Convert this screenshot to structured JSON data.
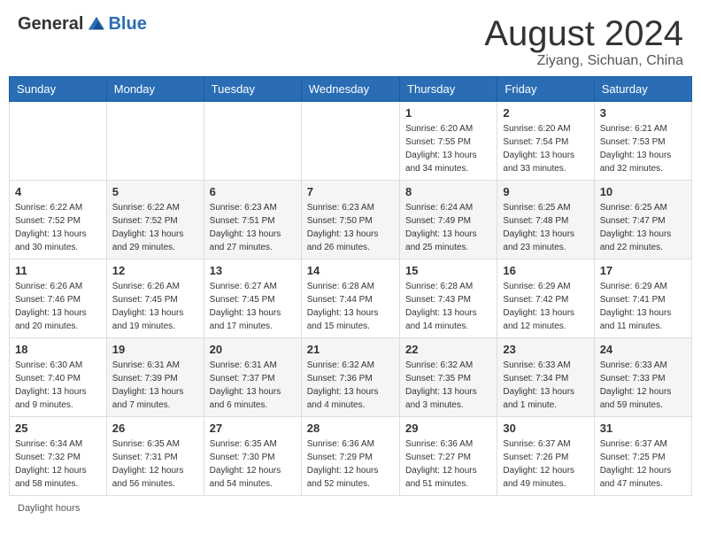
{
  "header": {
    "logo_general": "General",
    "logo_blue": "Blue",
    "month_year": "August 2024",
    "location": "Ziyang, Sichuan, China"
  },
  "days_of_week": [
    "Sunday",
    "Monday",
    "Tuesday",
    "Wednesday",
    "Thursday",
    "Friday",
    "Saturday"
  ],
  "weeks": [
    [
      {
        "day": "",
        "info": ""
      },
      {
        "day": "",
        "info": ""
      },
      {
        "day": "",
        "info": ""
      },
      {
        "day": "",
        "info": ""
      },
      {
        "day": "1",
        "info": "Sunrise: 6:20 AM\nSunset: 7:55 PM\nDaylight: 13 hours\nand 34 minutes."
      },
      {
        "day": "2",
        "info": "Sunrise: 6:20 AM\nSunset: 7:54 PM\nDaylight: 13 hours\nand 33 minutes."
      },
      {
        "day": "3",
        "info": "Sunrise: 6:21 AM\nSunset: 7:53 PM\nDaylight: 13 hours\nand 32 minutes."
      }
    ],
    [
      {
        "day": "4",
        "info": "Sunrise: 6:22 AM\nSunset: 7:52 PM\nDaylight: 13 hours\nand 30 minutes."
      },
      {
        "day": "5",
        "info": "Sunrise: 6:22 AM\nSunset: 7:52 PM\nDaylight: 13 hours\nand 29 minutes."
      },
      {
        "day": "6",
        "info": "Sunrise: 6:23 AM\nSunset: 7:51 PM\nDaylight: 13 hours\nand 27 minutes."
      },
      {
        "day": "7",
        "info": "Sunrise: 6:23 AM\nSunset: 7:50 PM\nDaylight: 13 hours\nand 26 minutes."
      },
      {
        "day": "8",
        "info": "Sunrise: 6:24 AM\nSunset: 7:49 PM\nDaylight: 13 hours\nand 25 minutes."
      },
      {
        "day": "9",
        "info": "Sunrise: 6:25 AM\nSunset: 7:48 PM\nDaylight: 13 hours\nand 23 minutes."
      },
      {
        "day": "10",
        "info": "Sunrise: 6:25 AM\nSunset: 7:47 PM\nDaylight: 13 hours\nand 22 minutes."
      }
    ],
    [
      {
        "day": "11",
        "info": "Sunrise: 6:26 AM\nSunset: 7:46 PM\nDaylight: 13 hours\nand 20 minutes."
      },
      {
        "day": "12",
        "info": "Sunrise: 6:26 AM\nSunset: 7:45 PM\nDaylight: 13 hours\nand 19 minutes."
      },
      {
        "day": "13",
        "info": "Sunrise: 6:27 AM\nSunset: 7:45 PM\nDaylight: 13 hours\nand 17 minutes."
      },
      {
        "day": "14",
        "info": "Sunrise: 6:28 AM\nSunset: 7:44 PM\nDaylight: 13 hours\nand 15 minutes."
      },
      {
        "day": "15",
        "info": "Sunrise: 6:28 AM\nSunset: 7:43 PM\nDaylight: 13 hours\nand 14 minutes."
      },
      {
        "day": "16",
        "info": "Sunrise: 6:29 AM\nSunset: 7:42 PM\nDaylight: 13 hours\nand 12 minutes."
      },
      {
        "day": "17",
        "info": "Sunrise: 6:29 AM\nSunset: 7:41 PM\nDaylight: 13 hours\nand 11 minutes."
      }
    ],
    [
      {
        "day": "18",
        "info": "Sunrise: 6:30 AM\nSunset: 7:40 PM\nDaylight: 13 hours\nand 9 minutes."
      },
      {
        "day": "19",
        "info": "Sunrise: 6:31 AM\nSunset: 7:39 PM\nDaylight: 13 hours\nand 7 minutes."
      },
      {
        "day": "20",
        "info": "Sunrise: 6:31 AM\nSunset: 7:37 PM\nDaylight: 13 hours\nand 6 minutes."
      },
      {
        "day": "21",
        "info": "Sunrise: 6:32 AM\nSunset: 7:36 PM\nDaylight: 13 hours\nand 4 minutes."
      },
      {
        "day": "22",
        "info": "Sunrise: 6:32 AM\nSunset: 7:35 PM\nDaylight: 13 hours\nand 3 minutes."
      },
      {
        "day": "23",
        "info": "Sunrise: 6:33 AM\nSunset: 7:34 PM\nDaylight: 13 hours\nand 1 minute."
      },
      {
        "day": "24",
        "info": "Sunrise: 6:33 AM\nSunset: 7:33 PM\nDaylight: 12 hours\nand 59 minutes."
      }
    ],
    [
      {
        "day": "25",
        "info": "Sunrise: 6:34 AM\nSunset: 7:32 PM\nDaylight: 12 hours\nand 58 minutes."
      },
      {
        "day": "26",
        "info": "Sunrise: 6:35 AM\nSunset: 7:31 PM\nDaylight: 12 hours\nand 56 minutes."
      },
      {
        "day": "27",
        "info": "Sunrise: 6:35 AM\nSunset: 7:30 PM\nDaylight: 12 hours\nand 54 minutes."
      },
      {
        "day": "28",
        "info": "Sunrise: 6:36 AM\nSunset: 7:29 PM\nDaylight: 12 hours\nand 52 minutes."
      },
      {
        "day": "29",
        "info": "Sunrise: 6:36 AM\nSunset: 7:27 PM\nDaylight: 12 hours\nand 51 minutes."
      },
      {
        "day": "30",
        "info": "Sunrise: 6:37 AM\nSunset: 7:26 PM\nDaylight: 12 hours\nand 49 minutes."
      },
      {
        "day": "31",
        "info": "Sunrise: 6:37 AM\nSunset: 7:25 PM\nDaylight: 12 hours\nand 47 minutes."
      }
    ]
  ],
  "footer": {
    "daylight_hours": "Daylight hours"
  }
}
